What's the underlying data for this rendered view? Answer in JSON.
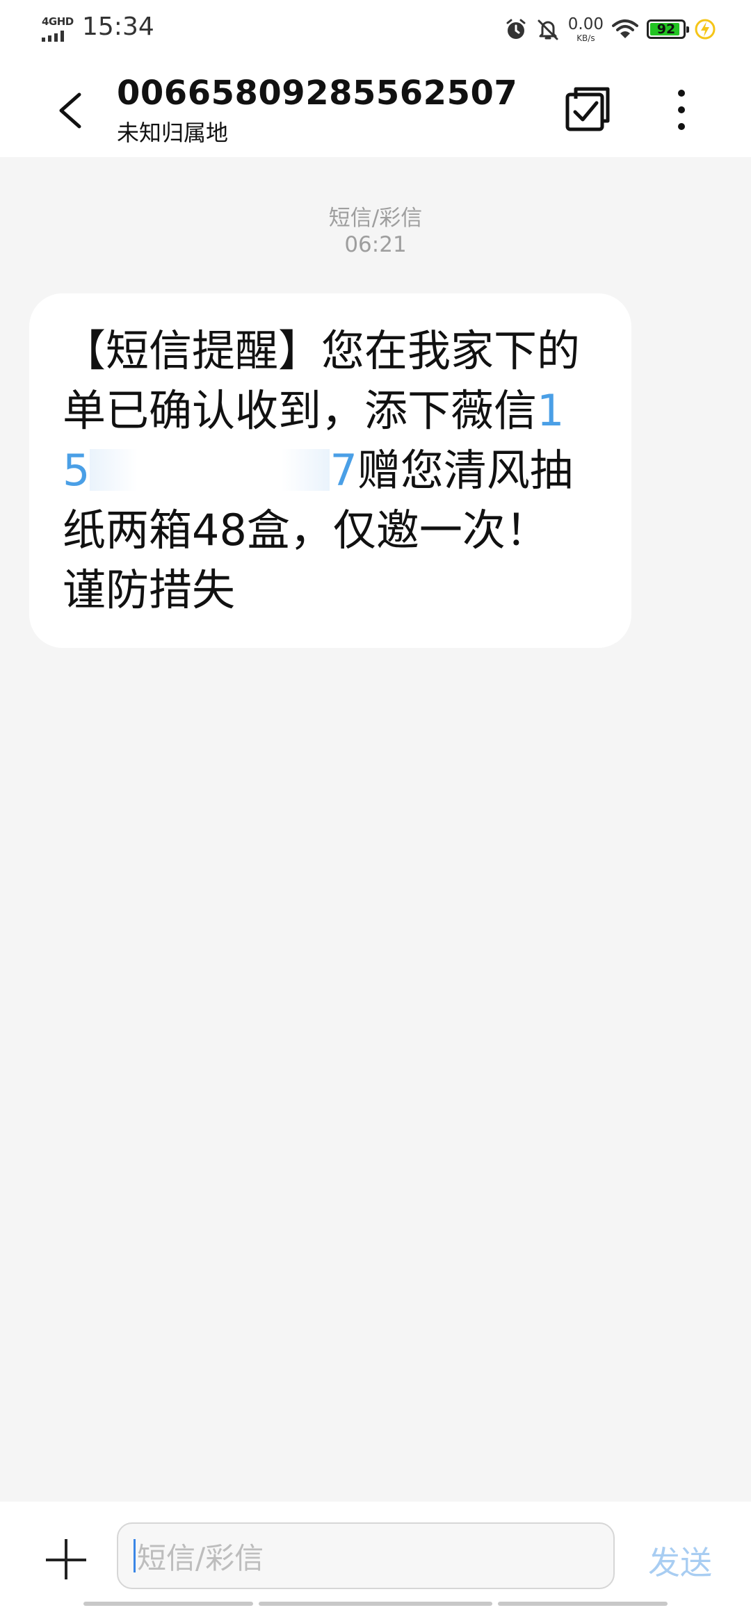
{
  "status_bar": {
    "network": "4GHD",
    "time": "15:34",
    "net_speed_value": "0.00",
    "net_speed_unit": "KB/s",
    "battery_percent": "92",
    "battery_level": 0.92,
    "icons": [
      "signal-icon",
      "alarm-icon",
      "bell-off-icon",
      "wifi-icon",
      "battery-icon",
      "charging-icon"
    ]
  },
  "header": {
    "title": "00665809285562507",
    "subtitle": "未知归属地",
    "icons": [
      "back-icon",
      "select-icon",
      "more-icon"
    ]
  },
  "conversation": {
    "channel_label": "短信/彩信",
    "timestamp": "06:21",
    "message": {
      "text_before": "【短信提醒】您在我家下的单已确认收到，添下薇信",
      "link_prefix": "15",
      "link_suffix": "7",
      "text_after": "赠您清风抽纸两箱48盒，仅邀一次！谨防措失"
    }
  },
  "composer": {
    "placeholder": "短信/彩信",
    "send_label": "发送",
    "icons": [
      "plus-icon"
    ]
  },
  "colors": {
    "link": "#4a9fe6",
    "send_disabled": "#a8cdf2",
    "battery_fill": "#22c322",
    "charging": "#f5c518",
    "background": "#f5f5f5"
  }
}
